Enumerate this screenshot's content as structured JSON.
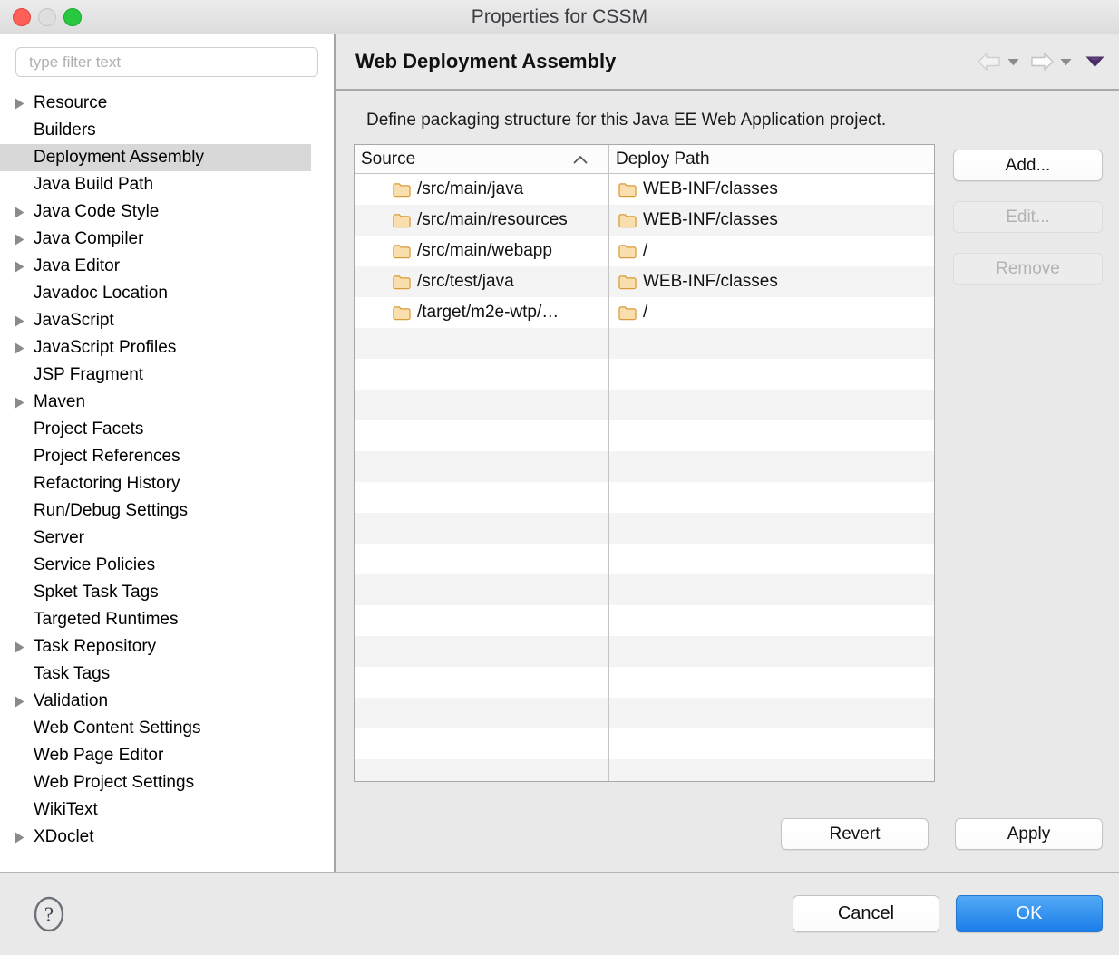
{
  "window": {
    "title": "Properties for CSSM",
    "traffic_lights": [
      {
        "name": "close-button",
        "color": "#ff5f57"
      },
      {
        "name": "minimize-button",
        "color": "#dedede"
      },
      {
        "name": "zoom-button",
        "color": "#28c840"
      }
    ]
  },
  "sidebar": {
    "filter": {
      "value": "",
      "placeholder": "type filter text"
    },
    "items": [
      {
        "label": "Resource",
        "expandable": true,
        "selected": false
      },
      {
        "label": "Builders",
        "expandable": false,
        "selected": false
      },
      {
        "label": "Deployment Assembly",
        "expandable": false,
        "selected": true
      },
      {
        "label": "Java Build Path",
        "expandable": false,
        "selected": false
      },
      {
        "label": "Java Code Style",
        "expandable": true,
        "selected": false
      },
      {
        "label": "Java Compiler",
        "expandable": true,
        "selected": false
      },
      {
        "label": "Java Editor",
        "expandable": true,
        "selected": false
      },
      {
        "label": "Javadoc Location",
        "expandable": false,
        "selected": false
      },
      {
        "label": "JavaScript",
        "expandable": true,
        "selected": false
      },
      {
        "label": "JavaScript Profiles",
        "expandable": true,
        "selected": false
      },
      {
        "label": "JSP Fragment",
        "expandable": false,
        "selected": false
      },
      {
        "label": "Maven",
        "expandable": true,
        "selected": false
      },
      {
        "label": "Project Facets",
        "expandable": false,
        "selected": false
      },
      {
        "label": "Project References",
        "expandable": false,
        "selected": false
      },
      {
        "label": "Refactoring History",
        "expandable": false,
        "selected": false
      },
      {
        "label": "Run/Debug Settings",
        "expandable": false,
        "selected": false
      },
      {
        "label": "Server",
        "expandable": false,
        "selected": false
      },
      {
        "label": "Service Policies",
        "expandable": false,
        "selected": false
      },
      {
        "label": "Spket Task Tags",
        "expandable": false,
        "selected": false
      },
      {
        "label": "Targeted Runtimes",
        "expandable": false,
        "selected": false
      },
      {
        "label": "Task Repository",
        "expandable": true,
        "selected": false
      },
      {
        "label": "Task Tags",
        "expandable": false,
        "selected": false
      },
      {
        "label": "Validation",
        "expandable": true,
        "selected": false
      },
      {
        "label": "Web Content Settings",
        "expandable": false,
        "selected": false
      },
      {
        "label": "Web Page Editor",
        "expandable": false,
        "selected": false
      },
      {
        "label": "Web Project Settings",
        "expandable": false,
        "selected": false
      },
      {
        "label": "WikiText",
        "expandable": false,
        "selected": false
      },
      {
        "label": "XDoclet",
        "expandable": true,
        "selected": false
      }
    ]
  },
  "page": {
    "title": "Web Deployment Assembly",
    "description": "Define packaging structure for this Java EE Web Application project.",
    "nav": {
      "back_icon": "back-arrow-icon",
      "back_menu_icon": "chevron-down-icon",
      "forward_icon": "forward-arrow-icon",
      "forward_menu_icon": "chevron-down-icon",
      "menu_icon": "caret-down-icon",
      "back_enabled": false,
      "forward_enabled": false
    }
  },
  "table": {
    "columns": [
      {
        "label": "Source",
        "sort": "ascending",
        "sort_icon": "sort-ascending-icon"
      },
      {
        "label": "Deploy Path",
        "sort": "none"
      }
    ],
    "rows": [
      {
        "source": "/src/main/java",
        "deploy": "WEB-INF/classes",
        "icon": "folder-icon"
      },
      {
        "source": "/src/main/resources",
        "deploy": "WEB-INF/classes",
        "icon": "folder-icon"
      },
      {
        "source": "/src/main/webapp",
        "deploy": "/",
        "icon": "folder-icon"
      },
      {
        "source": "/src/test/java",
        "deploy": "WEB-INF/classes",
        "icon": "folder-icon"
      },
      {
        "source": "/target/m2e-wtp/…",
        "deploy": "/",
        "icon": "folder-icon"
      }
    ],
    "empty_row_count": 15
  },
  "buttons": {
    "add": {
      "label": "Add...",
      "enabled": true
    },
    "edit": {
      "label": "Edit...",
      "enabled": false
    },
    "remove": {
      "label": "Remove",
      "enabled": false
    },
    "revert": {
      "label": "Revert",
      "enabled": true
    },
    "apply": {
      "label": "Apply",
      "enabled": true
    }
  },
  "footer": {
    "help_icon": "help-question-icon",
    "cancel": {
      "label": "Cancel"
    },
    "ok": {
      "label": "OK",
      "accent_color": "#1a7de8"
    }
  },
  "colors": {
    "selection": "#d8d8d8",
    "folder_fill": "#fadfae",
    "folder_border": "#d99a37",
    "ok_blue": "#1a7de8",
    "panel_bg": "#e9e9e9"
  }
}
